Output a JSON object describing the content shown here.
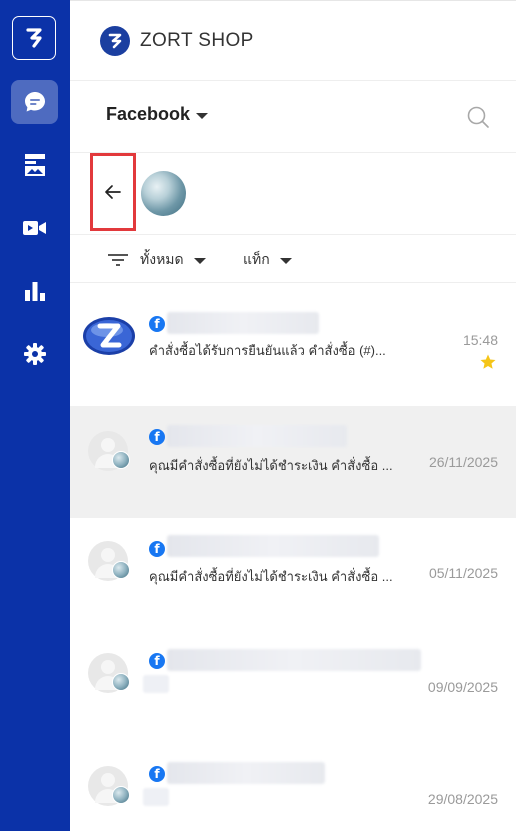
{
  "sidebar": {
    "icons": [
      "zort-logo-icon",
      "chat-icon",
      "store-icon",
      "video-icon",
      "chart-icon",
      "gear-icon"
    ],
    "active": "chat-icon"
  },
  "header": {
    "shop_name": "ZORT SHOP"
  },
  "channel": {
    "selected": "Facebook"
  },
  "filters": {
    "all_label": "ทั้งหมด",
    "tag_label": "แท็ก"
  },
  "conversations": [
    {
      "preview": "คำสั่งซื้อได้รับการยืนยันแล้ว คำสั่งซื้อ (#)...",
      "time": "15:48",
      "starred": true,
      "selected": false
    },
    {
      "preview": "คุณมีคำสั่งซื้อที่ยังไม่ได้ชำระเงิน คำสั่งซื้อ ...",
      "time": "26/11/2025",
      "starred": false,
      "selected": true
    },
    {
      "preview": "คุณมีคำสั่งซื้อที่ยังไม่ได้ชำระเงิน คำสั่งซื้อ ...",
      "time": "05/11/2025",
      "starred": false,
      "selected": false
    },
    {
      "preview": "",
      "time": "09/09/2025",
      "starred": false,
      "selected": false
    },
    {
      "preview": "",
      "time": "29/08/2025",
      "starred": false,
      "selected": false
    }
  ],
  "colors": {
    "sidebar_bg": "#0b32a8",
    "highlight_border": "#e2393c",
    "facebook_blue": "#1877f2",
    "star": "#f5c518"
  }
}
